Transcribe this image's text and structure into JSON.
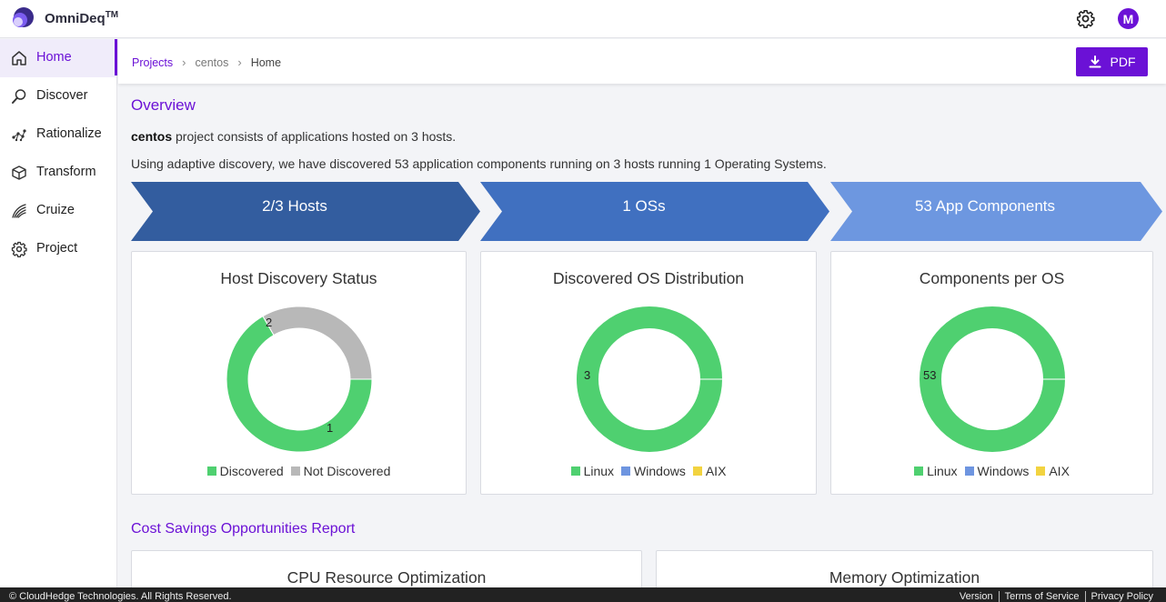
{
  "app": {
    "brand": "OmniDeq",
    "trademark": "TM",
    "avatar_initial": "M",
    "accent": "#6b11d6"
  },
  "sidebar": {
    "items": [
      {
        "label": "Home",
        "icon": "home-icon",
        "active": true
      },
      {
        "label": "Discover",
        "icon": "discover-icon"
      },
      {
        "label": "Rationalize",
        "icon": "rationalize-icon"
      },
      {
        "label": "Transform",
        "icon": "cube-icon"
      },
      {
        "label": "Cruize",
        "icon": "cruize-icon"
      },
      {
        "label": "Project",
        "icon": "gear-icon"
      }
    ]
  },
  "breadcrumb": {
    "projects": "Projects",
    "project": "centos",
    "current": "Home",
    "separator": "›"
  },
  "toolbar": {
    "pdf_label": "PDF"
  },
  "overview": {
    "title": "Overview",
    "project_name": "centos",
    "line1_rest": " project consists of applications hosted on 3 hosts.",
    "line2": "Using adaptive discovery, we have discovered 53 application components running on 3 hosts running 1 Operating Systems."
  },
  "steps": [
    {
      "label": "2/3 Hosts",
      "color": "#335d9f"
    },
    {
      "label": "1 OSs",
      "color": "#4070c0"
    },
    {
      "label": "53 App Components",
      "color": "#6d97e0"
    }
  ],
  "chart_data": [
    {
      "type": "pie",
      "title": "Host Discovery Status",
      "categories": [
        "Discovered",
        "Not Discovered"
      ],
      "values": [
        2,
        1
      ],
      "colors": [
        "#4fd070",
        "#b8b8b8"
      ],
      "legend": "bottom"
    },
    {
      "type": "pie",
      "title": "Discovered OS Distribution",
      "categories": [
        "Linux",
        "Windows",
        "AIX"
      ],
      "values": [
        3,
        0,
        0
      ],
      "colors": [
        "#4fd070",
        "#6e95e0",
        "#f2d340"
      ],
      "legend": "bottom"
    },
    {
      "type": "pie",
      "title": "Components per OS",
      "categories": [
        "Linux",
        "Windows",
        "AIX"
      ],
      "values": [
        53,
        0,
        0
      ],
      "colors": [
        "#4fd070",
        "#6e95e0",
        "#f2d340"
      ],
      "legend": "bottom"
    }
  ],
  "cost": {
    "title": "Cost Savings Opportunities Report",
    "cards": [
      "CPU Resource Optimization",
      "Memory Optimization"
    ]
  },
  "footer": {
    "copyright": "© CloudHedge Technologies. All Rights Reserved.",
    "links": [
      "Version",
      "Terms of Service",
      "Privacy Policy"
    ]
  }
}
